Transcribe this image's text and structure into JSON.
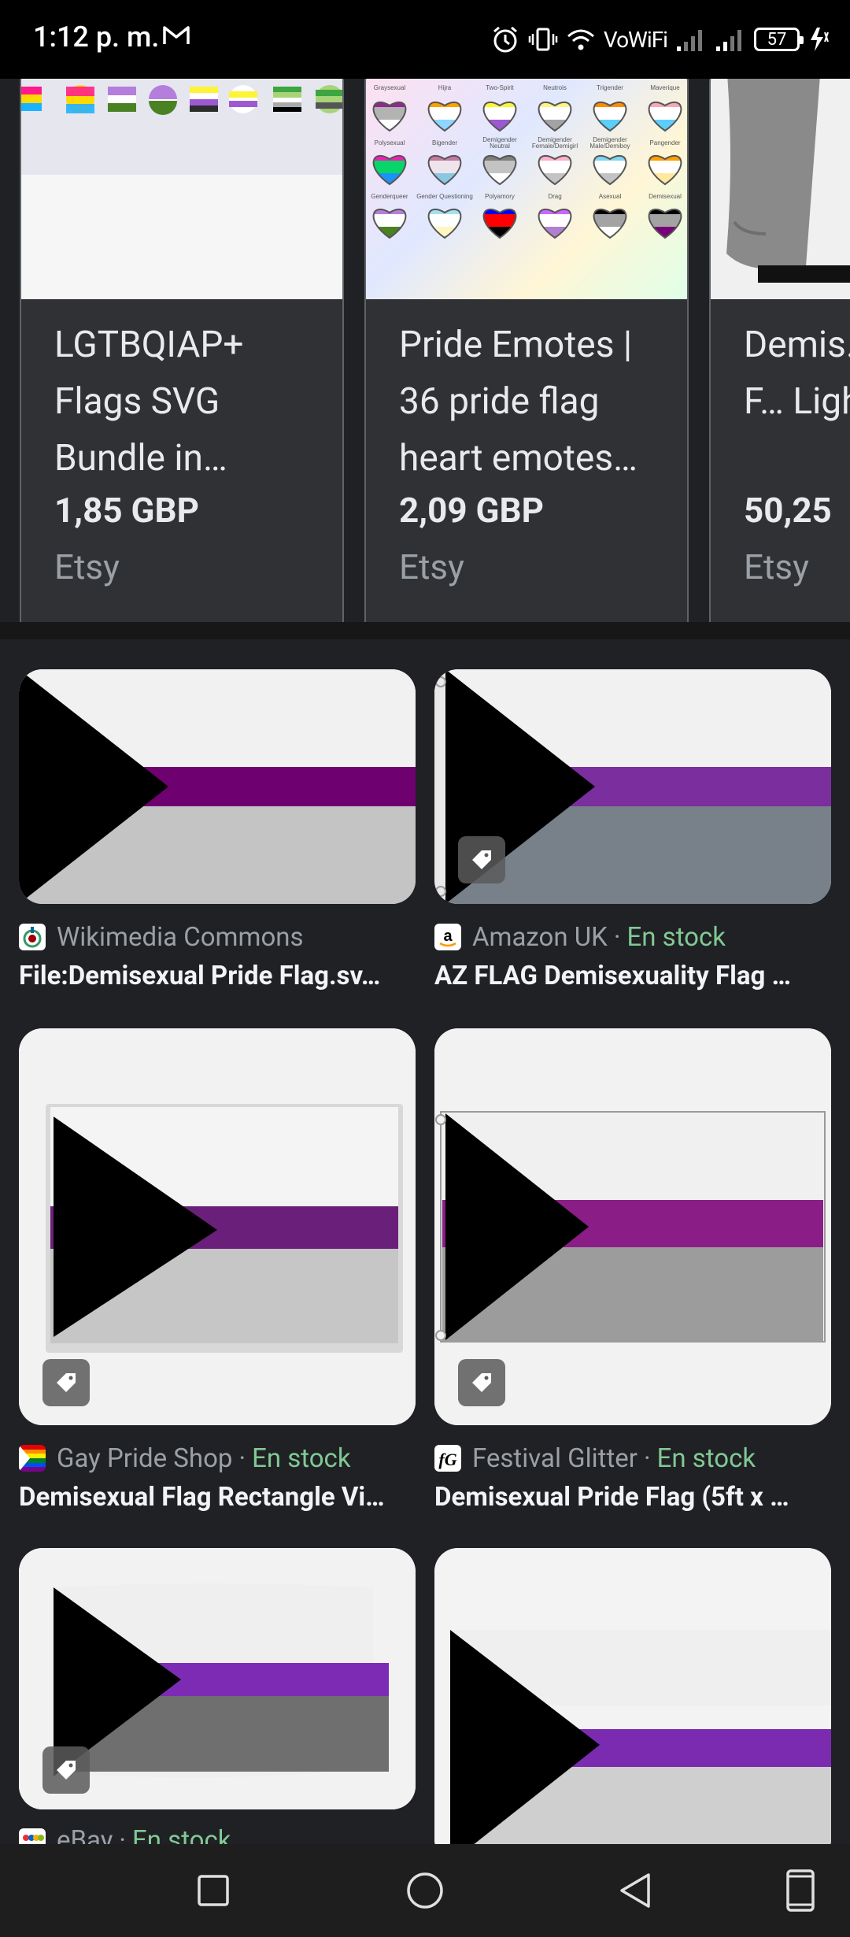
{
  "status_bar": {
    "time": "1:12 p. m.",
    "wifi_label": "VoWiFi",
    "battery": "57"
  },
  "shopping": {
    "cards": [
      {
        "title": "LGTBQIAP+ Flags SVG Bundle in…",
        "price": "1,85 GBP",
        "store": "Etsy"
      },
      {
        "title": "Pride Emotes | 36 pride flag heart emotes…",
        "price": "2,09 GBP",
        "store": "Etsy"
      },
      {
        "title": "Demis… Pride F… Lightw…",
        "price": "50,25",
        "store": "Etsy"
      }
    ],
    "heart_labels_row1": [
      "Graysexual",
      "Hijra",
      "Two-Spirit",
      "Neutrois",
      "Trigender",
      "Maverique"
    ],
    "heart_labels_row2": [
      "Polysexual",
      "Bigender",
      "Demigender Neutral",
      "Demigender Female/Demigirl",
      "Demigender Male/Demiboy",
      "Pangender"
    ],
    "heart_labels_row3": [
      "Genderqueer",
      "Gender Questioning",
      "Polyamory",
      "Drag",
      "Asexual",
      "Demisexual"
    ]
  },
  "results": [
    {
      "source": "Wikimedia Commons",
      "stock": "",
      "title": "File:Demisexual Pride Flag.sv…",
      "has_tag": false
    },
    {
      "source": "Amazon UK",
      "stock": "En stock",
      "title": "AZ FLAG Demisexuality Flag …",
      "has_tag": true
    },
    {
      "source": "Gay Pride Shop",
      "stock": "En stock",
      "title": "Demisexual Flag Rectangle Vi…",
      "has_tag": true
    },
    {
      "source": "Festival Glitter",
      "stock": "En stock",
      "title": "Demisexual Pride Flag (5ft x …",
      "has_tag": true
    },
    {
      "source": "eBay",
      "stock": "En stock",
      "title": "",
      "has_tag": true
    },
    {
      "source": "",
      "stock": "",
      "title": "",
      "has_tag": false
    }
  ],
  "separator_dot": "·",
  "colors": {
    "background": "#202124",
    "card": "#303134",
    "stock_green": "#81c995",
    "demi_purple": "#6e0070",
    "demi_grey": "#c4c4c4"
  },
  "nav": [
    "recents-button",
    "home-button",
    "back-button",
    "screen-button"
  ]
}
